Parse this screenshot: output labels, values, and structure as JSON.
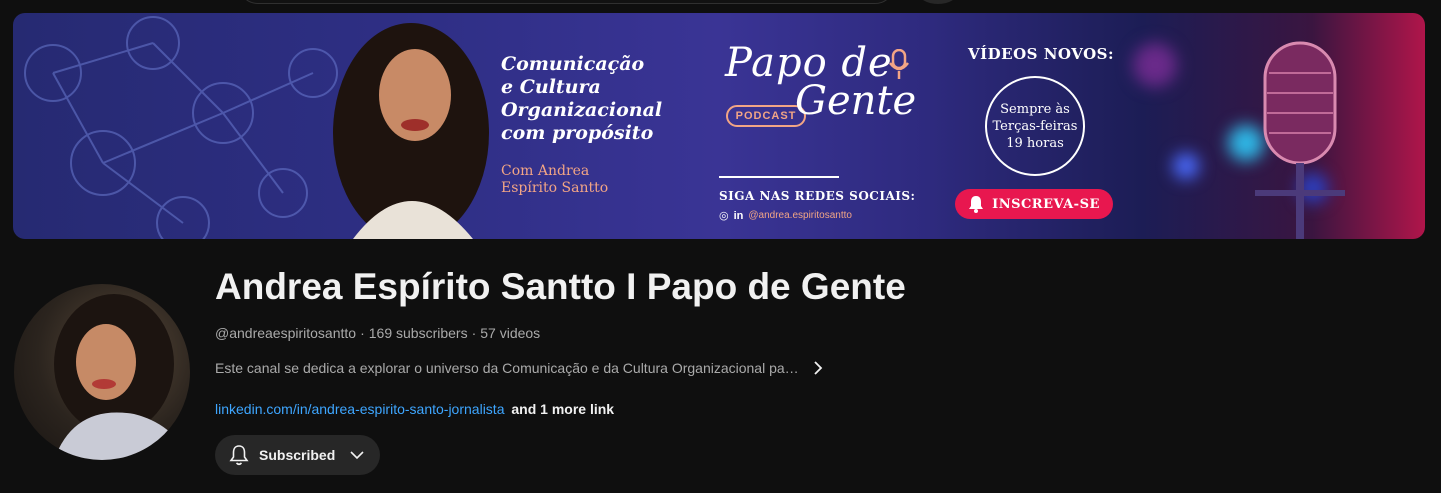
{
  "banner": {
    "tagline_lines": [
      "Comunicação",
      "e Cultura",
      "Organizacional",
      "com propósito"
    ],
    "host_lines": [
      "Com Andrea",
      "Espírito Santto"
    ],
    "logo_papo": "Papo de",
    "logo_gente": "Gente",
    "podcast_label": "PODCAST",
    "social_heading": "SIGA NAS REDES SOCIAIS:",
    "social_icon_instagram": "◎",
    "social_icon_linkedin": "in",
    "social_handle": "@andrea.espiritosantto",
    "videos_heading": "VÍDEOS NOVOS:",
    "schedule_lines": [
      "Sempre às",
      "Terças-feiras",
      "19 horas"
    ],
    "subscribe_label": "INSCREVA-SE",
    "colors": {
      "accent_peach": "#f2a585",
      "accent_pink": "#e8174f",
      "base_purple": "#2f2f86"
    }
  },
  "channel": {
    "title": "Andrea Espírito Santto I Papo de Gente",
    "handle": "@andreaespiritosantto",
    "separator": "·",
    "subscribers": "169 subscribers",
    "videos": "57 videos",
    "description": "Este canal se dedica a explorar o universo da Comunicação e da Cultura Organizacional pa…",
    "link_text": "linkedin.com/in/andrea-espirito-santo-jornalista",
    "more_links": "and 1 more link",
    "subscribed_label": "Subscribed",
    "icons": {
      "bell": "bell-icon",
      "chevron_down": "chevron-down-icon",
      "chevron_right": "chevron-right-icon"
    },
    "colors": {
      "link": "#3ea6ff",
      "muted_text": "#aaaaaa",
      "button_bg": "#272727"
    }
  }
}
